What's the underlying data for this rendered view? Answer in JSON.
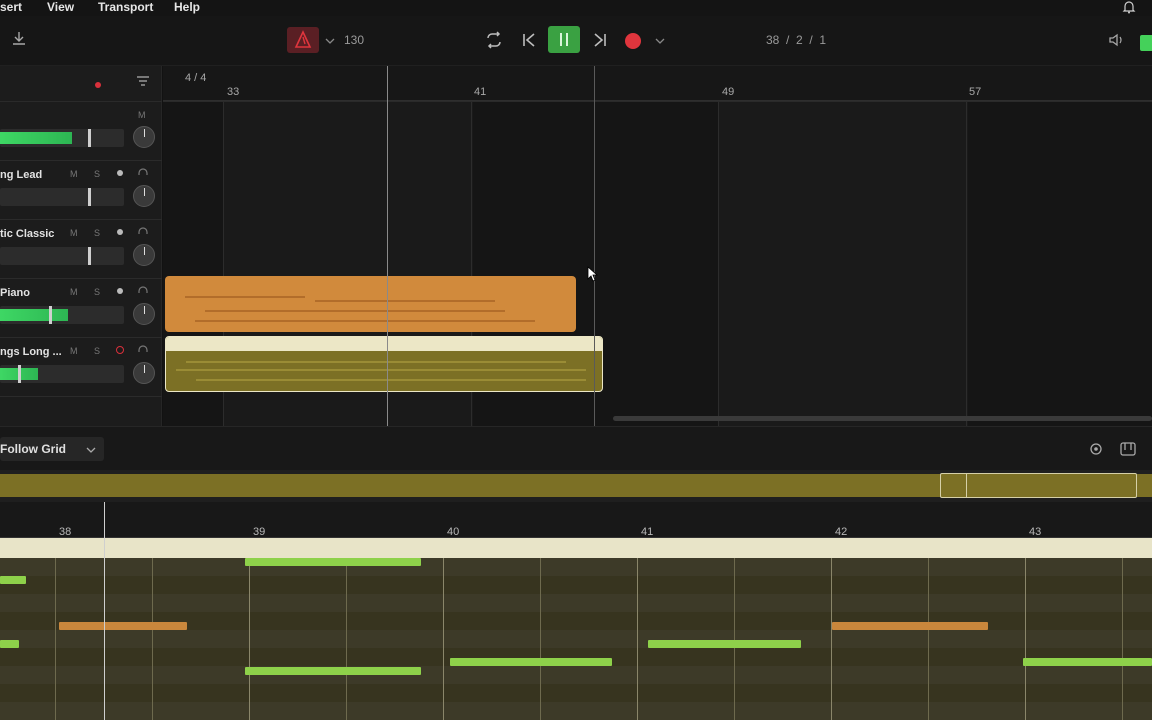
{
  "menubar": {
    "items": [
      "sert",
      "View",
      "Transport",
      "Help"
    ]
  },
  "transport": {
    "tempo": "130",
    "position": "38  /  2  /  1",
    "colors": {
      "play": "#3aa142",
      "record": "#e0353d",
      "metronome": "#5a1f24"
    }
  },
  "tracks": [
    {
      "name": "",
      "has_meter": true,
      "meter_level": 0.58
    },
    {
      "name": "ng Lead",
      "has_meter": false
    },
    {
      "name": "tic Classic",
      "has_meter": false
    },
    {
      "name": "Piano",
      "has_meter": true,
      "meter_level": 0.55
    },
    {
      "name": "ngs Long ...",
      "has_meter": true,
      "meter_level": 0.3
    }
  ],
  "track_buttons": {
    "mute": "M",
    "solo": "S"
  },
  "arrange": {
    "time_signature": "4 / 4",
    "bars": [
      "33",
      "41",
      "49",
      "57"
    ]
  },
  "clips": {
    "piano": {
      "color": "#d18a3c"
    },
    "strings": {
      "color": "#7c7025",
      "header_color": "#ece7c6"
    }
  },
  "editor": {
    "grid_mode": "Follow Grid",
    "bars": [
      "38",
      "39",
      "40",
      "41",
      "42",
      "43"
    ],
    "note_colors": {
      "green": "#8ed14a",
      "orange": "#c9873c"
    }
  }
}
